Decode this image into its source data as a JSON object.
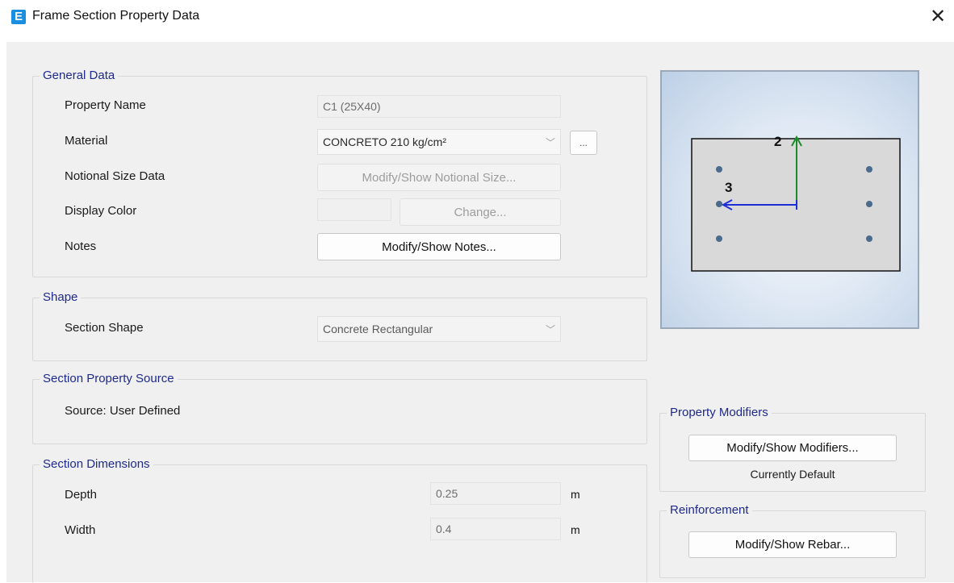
{
  "window": {
    "title": "Frame Section Property Data",
    "app_icon_letter": "E",
    "close_glyph": "✕"
  },
  "general": {
    "legend": "General Data",
    "property_name_label": "Property Name",
    "property_name_value": "C1 (25X40)",
    "material_label": "Material",
    "material_value": "CONCRETO 210 kg/cm²",
    "material_more": "...",
    "notional_label": "Notional Size Data",
    "notional_button": "Modify/Show Notional Size...",
    "display_color_label": "Display Color",
    "change_button": "Change...",
    "notes_label": "Notes",
    "notes_button": "Modify/Show Notes..."
  },
  "shape": {
    "legend": "Shape",
    "section_shape_label": "Section Shape",
    "section_shape_value": "Concrete Rectangular"
  },
  "source": {
    "legend": "Section Property Source",
    "text": "Source:  User Defined"
  },
  "dimensions": {
    "legend": "Section Dimensions",
    "depth_label": "Depth",
    "depth_value": "0.25",
    "depth_unit": "m",
    "width_label": "Width",
    "width_value": "0.4",
    "width_unit": "m"
  },
  "preview": {
    "axis2_label": "2",
    "axis3_label": "3",
    "axis2_color": "#1a8a2a",
    "axis3_color": "#1f2fd6",
    "section_fill": "#d9d9d9",
    "rebar_color": "#4a6a8e"
  },
  "modifiers": {
    "legend": "Property Modifiers",
    "button": "Modify/Show Modifiers...",
    "status": "Currently Default"
  },
  "reinforcement": {
    "legend": "Reinforcement",
    "button": "Modify/Show Rebar..."
  },
  "icons": {
    "dropdown": "chevron-down-icon",
    "close": "close-icon",
    "app": "etabs-app-icon"
  },
  "colors": {
    "legend_text": "#1f2a8a",
    "dialog_bg": "#f0f0f0",
    "app_icon": "#1a8fe0"
  }
}
